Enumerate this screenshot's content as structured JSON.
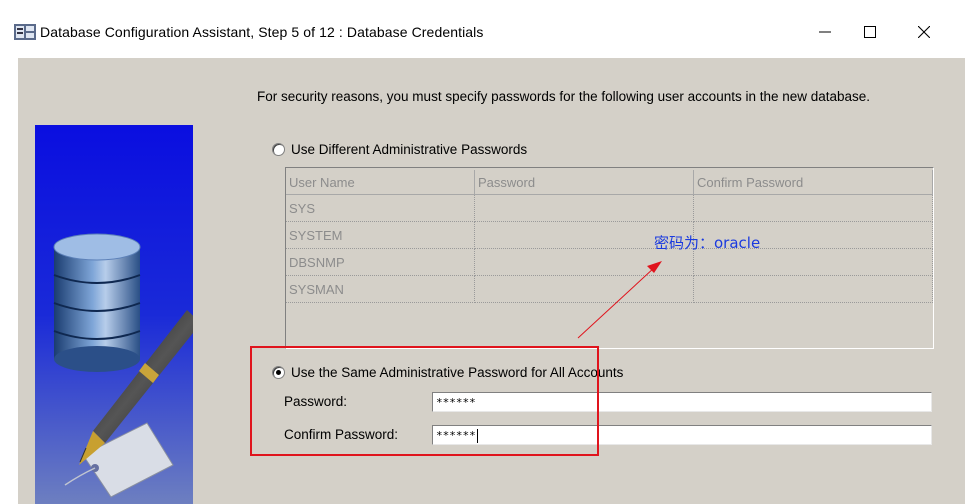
{
  "window": {
    "title": "Database Configuration Assistant, Step 5 of 12 : Database Credentials",
    "controls": [
      "minimize-icon",
      "maximize-icon",
      "close-icon"
    ]
  },
  "intro_text": "For security reasons, you must specify passwords for the following user accounts in the new database.",
  "option_different": {
    "label": "Use Different Administrative Passwords",
    "selected": false
  },
  "accounts_table": {
    "columns": [
      "User Name",
      "Password",
      "Confirm Password"
    ],
    "rows": [
      [
        "SYS",
        "",
        ""
      ],
      [
        "SYSTEM",
        "",
        ""
      ],
      [
        "DBSNMP",
        "",
        ""
      ],
      [
        "SYSMAN",
        "",
        ""
      ]
    ]
  },
  "annotation": {
    "text": "密码为：oracle",
    "color": "#1a3adf",
    "arrow_color": "#e0141d",
    "box_color": "#e0141d"
  },
  "option_same": {
    "label": "Use the Same Administrative Password for All Accounts",
    "selected": true
  },
  "password_field": {
    "label": "Password:",
    "value": "******"
  },
  "confirm_field": {
    "label": "Confirm Password:",
    "value": "******"
  },
  "colors": {
    "panel_bg": "#d4d0c8",
    "banner_blue": "#0b0fd8"
  }
}
